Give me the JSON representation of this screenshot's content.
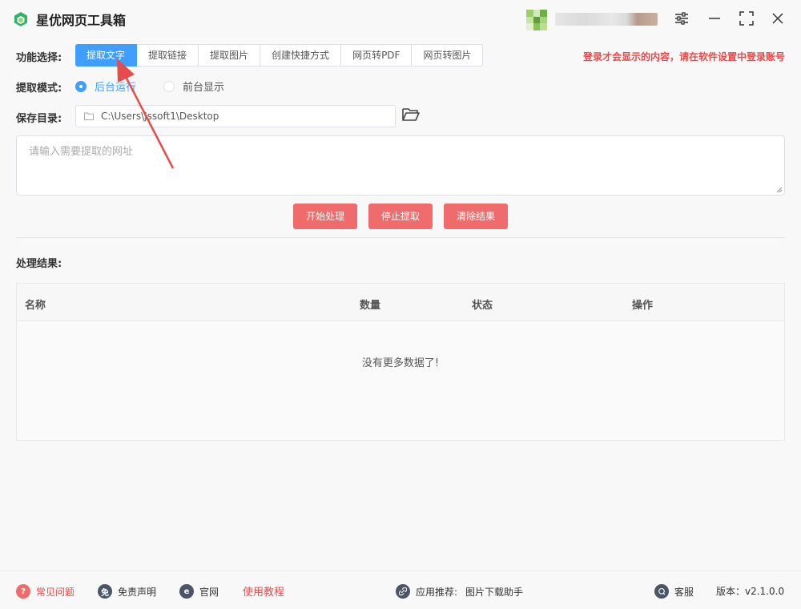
{
  "window": {
    "title": "星优网页工具箱",
    "icons": {
      "logo": "cube-icon",
      "settings": "sliders-icon",
      "minimize": "minimize-icon",
      "maximize": "maximize-icon",
      "close": "close-icon"
    }
  },
  "function_select": {
    "label": "功能选择:",
    "tabs": [
      {
        "label": "提取文字",
        "active": true
      },
      {
        "label": "提取链接",
        "active": false
      },
      {
        "label": "提取图片",
        "active": false
      },
      {
        "label": "创建快捷方式",
        "active": false
      },
      {
        "label": "网页转PDF",
        "active": false
      },
      {
        "label": "网页转图片",
        "active": false
      }
    ],
    "login_hint": "登录才会显示的内容，请在软件设置中登录账号"
  },
  "mode": {
    "label": "提取模式:",
    "options": [
      {
        "label": "后台运行",
        "checked": true
      },
      {
        "label": "前台显示",
        "checked": false
      }
    ]
  },
  "save_dir": {
    "label": "保存目录:",
    "value": "C:\\Users\\Jssoft1\\Desktop"
  },
  "url_input": {
    "placeholder": "请输入需要提取的网址"
  },
  "actions": {
    "start": "开始处理",
    "stop": "停止提取",
    "clear": "清除结果"
  },
  "results": {
    "label": "处理结果:",
    "columns": [
      "名称",
      "数量",
      "状态",
      "操作"
    ],
    "empty_text": "没有更多数据了!"
  },
  "footer": {
    "faq": "常见问题",
    "disclaimer": "免责声明",
    "website": "官网",
    "tutorial": "使用教程",
    "recommend_label": "应用推荐:",
    "recommend_app": "图片下载助手",
    "support": "客服",
    "version": "版本：v2.1.0.0"
  },
  "colors": {
    "accent": "#409eff",
    "button": "#f06b6b",
    "hint": "#e84b4b",
    "arrow": "#e84b4b"
  }
}
